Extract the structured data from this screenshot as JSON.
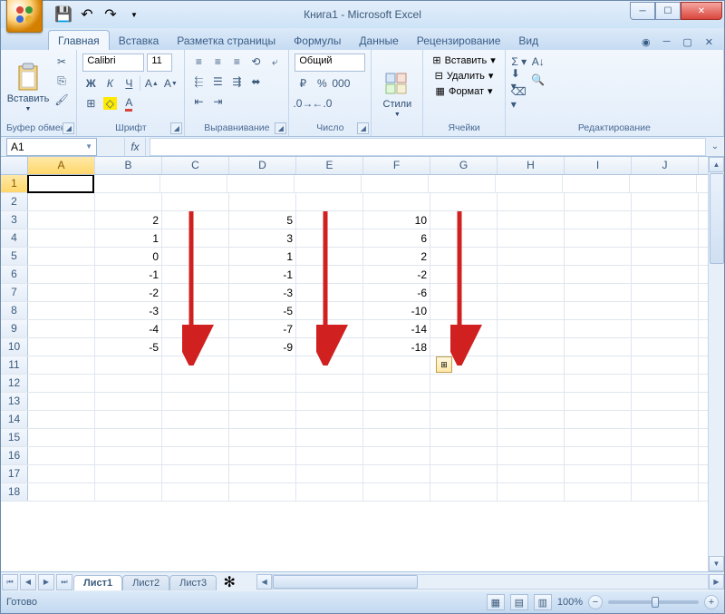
{
  "title": "Книга1 - Microsoft Excel",
  "qat": {
    "save": "💾",
    "undo": "↶",
    "redo": "↷"
  },
  "tabs": {
    "items": [
      "Главная",
      "Вставка",
      "Разметка страницы",
      "Формулы",
      "Данные",
      "Рецензирование",
      "Вид"
    ],
    "activeIndex": 0
  },
  "ribbon": {
    "clipboard": {
      "title": "Буфер обмена",
      "paste": "Вставить"
    },
    "font": {
      "title": "Шрифт",
      "family": "Calibri",
      "size": "11"
    },
    "alignment": {
      "title": "Выравнивание"
    },
    "number": {
      "title": "Число",
      "format": "Общий"
    },
    "styles": {
      "title": "",
      "label": "Стили"
    },
    "cells": {
      "title": "Ячейки",
      "insert": "Вставить",
      "delete": "Удалить",
      "format": "Формат"
    },
    "editing": {
      "title": "Редактирование"
    }
  },
  "namebox": "A1",
  "columns": [
    "A",
    "B",
    "C",
    "D",
    "E",
    "F",
    "G",
    "H",
    "I",
    "J"
  ],
  "rowCount": 18,
  "activeCell": {
    "row": 1,
    "col": "A"
  },
  "cells": {
    "B3": "2",
    "B4": "1",
    "B5": "0",
    "B6": "-1",
    "B7": "-2",
    "B8": "-3",
    "B9": "-4",
    "B10": "-5",
    "D3": "5",
    "D4": "3",
    "D5": "1",
    "D6": "-1",
    "D7": "-3",
    "D8": "-5",
    "D9": "-7",
    "D10": "-9",
    "F3": "10",
    "F4": "6",
    "F5": "2",
    "F6": "-2",
    "F7": "-6",
    "F8": "-10",
    "F9": "-14",
    "F10": "-18"
  },
  "sheets": {
    "items": [
      "Лист1",
      "Лист2",
      "Лист3"
    ],
    "activeIndex": 0
  },
  "status": {
    "ready": "Готово",
    "zoom": "100%"
  }
}
